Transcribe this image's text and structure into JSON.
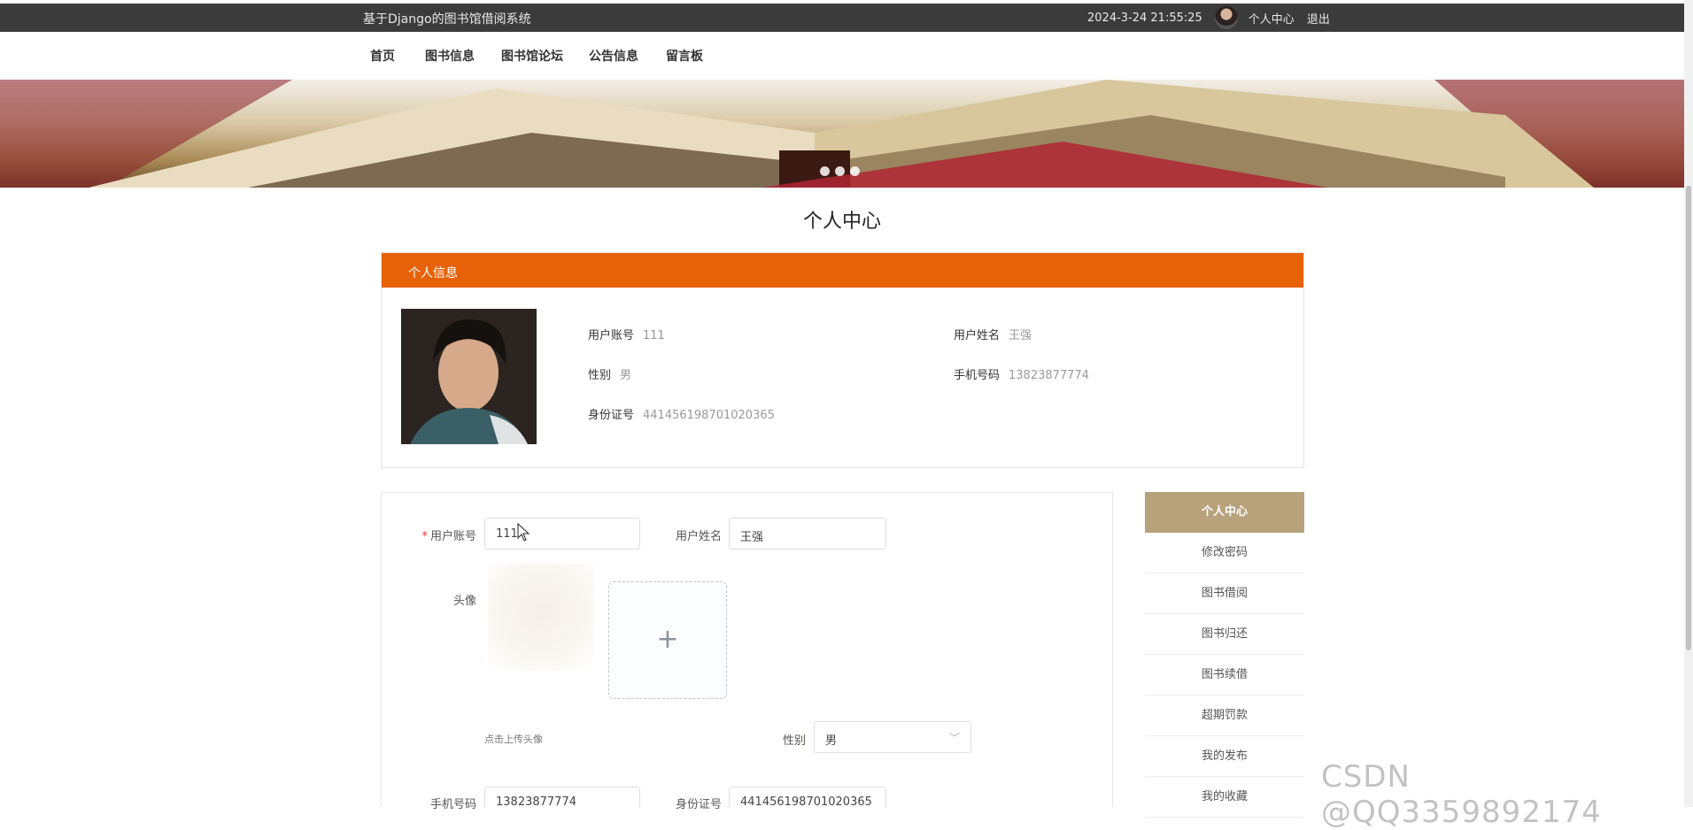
{
  "topbar": {
    "site_title": "基于Django的图书馆借阅系统",
    "datetime": "2024-3-24 21:55:25",
    "personal_center": "个人中心",
    "logout": "退出"
  },
  "nav": {
    "items": [
      {
        "label": "首页"
      },
      {
        "label": "图书信息"
      },
      {
        "label": "图书馆论坛"
      },
      {
        "label": "公告信息"
      },
      {
        "label": "留言板"
      }
    ]
  },
  "page_title": "个人中心",
  "info": {
    "header": "个人信息",
    "fields": [
      {
        "label": "用户账号",
        "value": "111"
      },
      {
        "label": "用户姓名",
        "value": "王强"
      },
      {
        "label": "性别",
        "value": "男"
      },
      {
        "label": "手机号码",
        "value": "13823877774"
      },
      {
        "label": "身份证号",
        "value": "441456198701020365"
      }
    ]
  },
  "form": {
    "account_label": "用户账号",
    "account_value": "111",
    "name_label": "用户姓名",
    "name_value": "王强",
    "avatar_label": "头像",
    "upload_hint": "点击上传头像",
    "plus": "+",
    "gender_label": "性别",
    "gender_value": "男",
    "phone_label": "手机号码",
    "phone_value": "13823877774",
    "id_label": "身份证号",
    "id_value": "441456198701020365"
  },
  "side_menu": {
    "items": [
      {
        "label": "个人中心"
      },
      {
        "label": "修改密码"
      },
      {
        "label": "图书借阅"
      },
      {
        "label": "图书归还"
      },
      {
        "label": "图书续借"
      },
      {
        "label": "超期罚款"
      },
      {
        "label": "我的发布"
      },
      {
        "label": "我的收藏"
      }
    ]
  },
  "carousel": {
    "dot_count": 3,
    "active_index": 0
  },
  "colors": {
    "accent_orange": "#e8620a",
    "menu_active": "#b7a27c",
    "topbar": "#3b3b3b"
  },
  "watermark": "CSDN @QQ3359892174"
}
